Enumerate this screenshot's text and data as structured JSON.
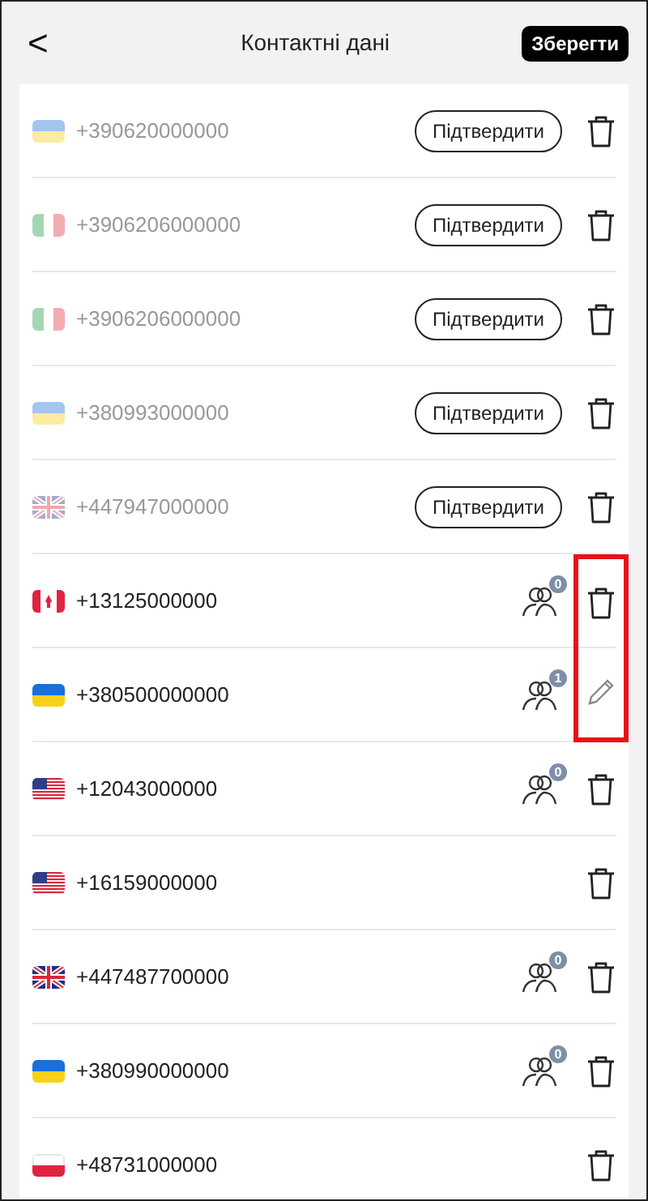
{
  "header": {
    "back": "<",
    "title": "Контактні дані",
    "save": "Зберегти"
  },
  "contacts": [
    {
      "flag": {
        "kind": "ua"
      },
      "number": "+390620000000",
      "verified": false,
      "confirm": "Підтвердити",
      "kind": "delete",
      "highlighted": false
    },
    {
      "flag": {
        "kind": "it"
      },
      "number": "+3906206000000",
      "verified": false,
      "confirm": "Підтвердити",
      "kind": "delete",
      "highlighted": false
    },
    {
      "flag": {
        "kind": "it"
      },
      "number": "+3906206000000",
      "verified": false,
      "confirm": "Підтвердити",
      "kind": "delete",
      "highlighted": false
    },
    {
      "flag": {
        "kind": "ua"
      },
      "number": "+380993000000",
      "verified": false,
      "confirm": "Підтвердити",
      "kind": "delete",
      "highlighted": false
    },
    {
      "flag": {
        "kind": "gb"
      },
      "number": "+447947000000",
      "verified": false,
      "confirm": "Підтвердити",
      "kind": "delete",
      "highlighted": false
    },
    {
      "flag": {
        "kind": "ca"
      },
      "number": "+13125000000",
      "verified": true,
      "count": "0",
      "kind": "delete",
      "highlighted": true
    },
    {
      "flag": {
        "kind": "ua"
      },
      "number": "+380500000000",
      "verified": true,
      "count": "1",
      "kind": "edit",
      "highlighted": true
    },
    {
      "flag": {
        "kind": "us"
      },
      "number": "+12043000000",
      "verified": true,
      "count": "0",
      "kind": "delete",
      "highlighted": false
    },
    {
      "flag": {
        "kind": "us"
      },
      "number": "+16159000000",
      "verified": true,
      "kind": "delete",
      "highlighted": false
    },
    {
      "flag": {
        "kind": "gb"
      },
      "number": "+447487700000",
      "verified": true,
      "count": "0",
      "kind": "delete",
      "highlighted": false
    },
    {
      "flag": {
        "kind": "ua"
      },
      "number": "+380990000000",
      "verified": true,
      "count": "0",
      "kind": "delete",
      "highlighted": false
    },
    {
      "flag": {
        "kind": "pl"
      },
      "number": "+48731000000",
      "verified": true,
      "kind": "delete",
      "highlighted": false
    }
  ]
}
